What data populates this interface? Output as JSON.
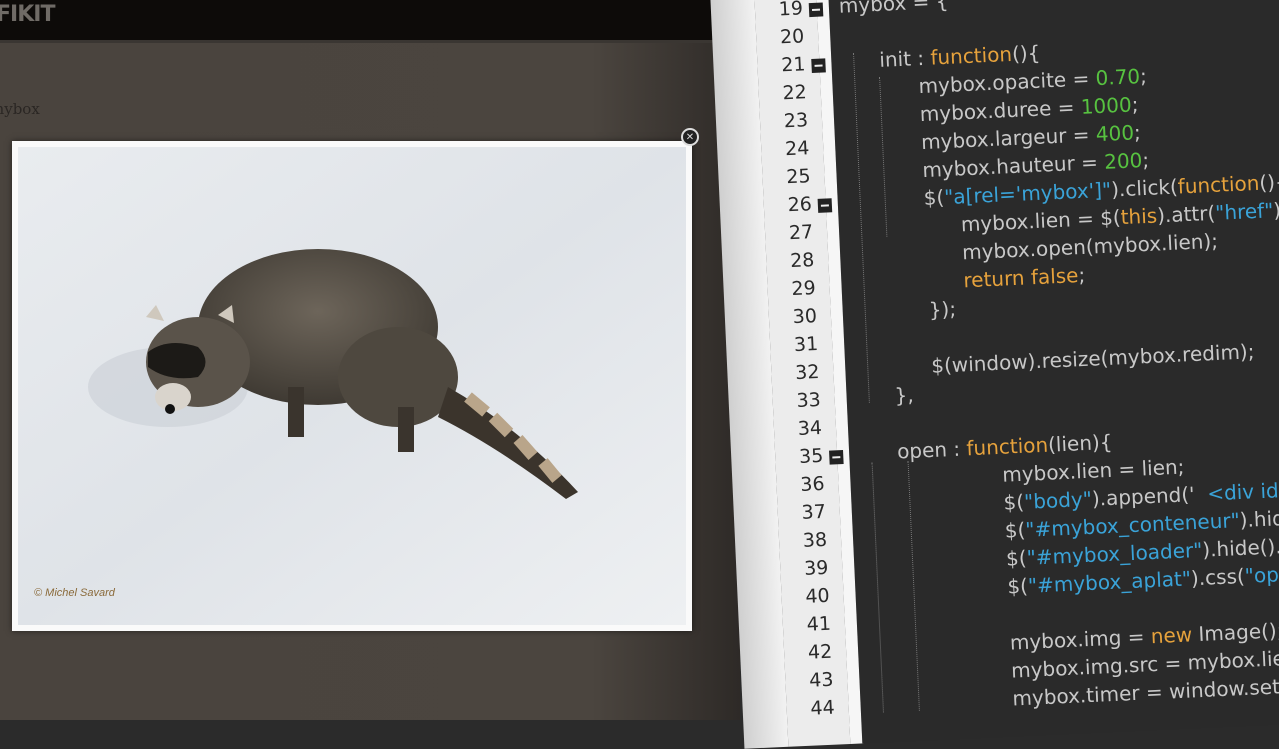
{
  "site": {
    "logo": "FIKIT",
    "page_title": "mybox"
  },
  "lightbox": {
    "photo_credit": "© Michel Savard",
    "close_icon": "close-icon",
    "photo_subject": "raccoon on snow"
  },
  "editor": {
    "colors": {
      "keyword": "#e6a23c",
      "number": "#57c240",
      "string": "#3aa3d8",
      "text": "#c8c8c8",
      "background": "#2a2a2a"
    },
    "folds": [
      19,
      21,
      26,
      35
    ],
    "lines": [
      {
        "n": "19",
        "indent": 0,
        "tokens": [
          [
            "mybox = {",
            "p"
          ]
        ]
      },
      {
        "n": "20",
        "indent": 0,
        "tokens": []
      },
      {
        "n": "21",
        "indent": 1,
        "tokens": [
          [
            "init : ",
            "p"
          ],
          [
            "function",
            "kw"
          ],
          [
            "(){",
            "p"
          ]
        ]
      },
      {
        "n": "22",
        "indent": 2,
        "tokens": [
          [
            "mybox.opacite = ",
            "p"
          ],
          [
            "0.70",
            "num"
          ],
          [
            ";",
            "p"
          ]
        ]
      },
      {
        "n": "23",
        "indent": 2,
        "tokens": [
          [
            "mybox.duree = ",
            "p"
          ],
          [
            "1000",
            "num"
          ],
          [
            ";",
            "p"
          ]
        ]
      },
      {
        "n": "24",
        "indent": 2,
        "tokens": [
          [
            "mybox.largeur = ",
            "p"
          ],
          [
            "400",
            "num"
          ],
          [
            ";",
            "p"
          ]
        ]
      },
      {
        "n": "25",
        "indent": 2,
        "tokens": [
          [
            "mybox.hauteur = ",
            "p"
          ],
          [
            "200",
            "num"
          ],
          [
            ";",
            "p"
          ]
        ]
      },
      {
        "n": "26",
        "indent": 2,
        "tokens": [
          [
            "$(",
            "p"
          ],
          [
            "\"a[rel='mybox']\"",
            "str"
          ],
          [
            ").click(",
            "p"
          ],
          [
            "function",
            "kw"
          ],
          [
            "(){",
            "p"
          ]
        ]
      },
      {
        "n": "27",
        "indent": 3,
        "tokens": [
          [
            "mybox.lien = $(",
            "p"
          ],
          [
            "this",
            "kw"
          ],
          [
            ").attr(",
            "p"
          ],
          [
            "\"href\"",
            "str"
          ],
          [
            ");",
            "p"
          ]
        ]
      },
      {
        "n": "28",
        "indent": 3,
        "tokens": [
          [
            "mybox.open(mybox.lien);",
            "p"
          ]
        ]
      },
      {
        "n": "29",
        "indent": 3,
        "tokens": [
          [
            "return false",
            "kw"
          ],
          [
            ";",
            "p"
          ]
        ]
      },
      {
        "n": "30",
        "indent": 2,
        "tokens": [
          [
            "});",
            "p"
          ]
        ]
      },
      {
        "n": "31",
        "indent": 0,
        "tokens": []
      },
      {
        "n": "32",
        "indent": 2,
        "tokens": [
          [
            "$(window).resize(mybox.redim);",
            "p"
          ]
        ]
      },
      {
        "n": "33",
        "indent": 1,
        "tokens": [
          [
            "},",
            "p"
          ]
        ]
      },
      {
        "n": "34",
        "indent": 0,
        "tokens": []
      },
      {
        "n": "35",
        "indent": 1,
        "tokens": [
          [
            "open : ",
            "p"
          ],
          [
            "function",
            "kw"
          ],
          [
            "(lien){",
            "p"
          ]
        ]
      },
      {
        "n": "36",
        "indent": 3,
        "tokens": [
          [
            "mybox.lien = lien;",
            "p"
          ]
        ]
      },
      {
        "n": "37",
        "indent": 3,
        "tokens": [
          [
            "$(",
            "p"
          ],
          [
            "\"body\"",
            "str"
          ],
          [
            ").append('  ",
            "p"
          ],
          [
            "<div id=\"mybox_aplat\"></div>",
            "str"
          ]
        ]
      },
      {
        "n": "38",
        "indent": 3,
        "tokens": [
          [
            "$(",
            "p"
          ],
          [
            "\"#mybox_conteneur\"",
            "str"
          ],
          [
            ").hide().fadeIn();",
            "p"
          ]
        ]
      },
      {
        "n": "39",
        "indent": 3,
        "tokens": [
          [
            "$(",
            "p"
          ],
          [
            "\"#mybox_loader\"",
            "str"
          ],
          [
            ").hide().fadeIn();",
            "p"
          ]
        ]
      },
      {
        "n": "40",
        "indent": 3,
        "tokens": [
          [
            "$(",
            "p"
          ],
          [
            "\"#mybox_aplat\"",
            "str"
          ],
          [
            ").css(",
            "p"
          ],
          [
            "\"opacity\"",
            "str"
          ]
        ]
      },
      {
        "n": "41",
        "indent": 0,
        "tokens": []
      },
      {
        "n": "42",
        "indent": 3,
        "tokens": [
          [
            "mybox.img = ",
            "p"
          ],
          [
            "new",
            "kw"
          ],
          [
            " Image();",
            "p"
          ]
        ]
      },
      {
        "n": "43",
        "indent": 3,
        "tokens": [
          [
            "mybox.img.src = mybox.lien;",
            "p"
          ]
        ]
      },
      {
        "n": "44",
        "indent": 3,
        "tokens": [
          [
            "mybox.timer = window.setInterval(",
            "p"
          ]
        ]
      }
    ]
  }
}
